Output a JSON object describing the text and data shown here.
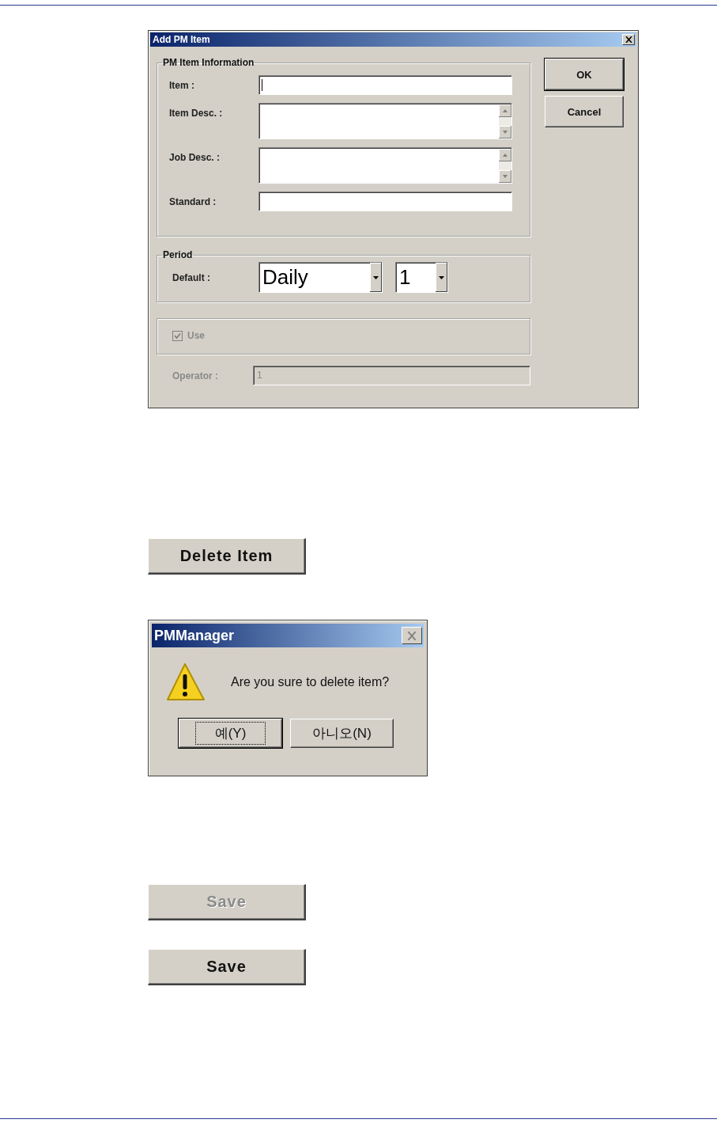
{
  "add_pm_item_dialog": {
    "title": "Add PM Item",
    "info_group": {
      "title": "PM Item Information",
      "fields": [
        {
          "label": "Item :",
          "kind": "text",
          "focused": true
        },
        {
          "label": "Item Desc. :",
          "kind": "memo",
          "focused": false
        },
        {
          "label": "Job Desc. :",
          "kind": "memo",
          "focused": false
        },
        {
          "label": "Standard :",
          "kind": "text",
          "focused": false
        }
      ]
    },
    "period_group": {
      "title": "Period",
      "label": "Default :",
      "dropdowns": [
        {
          "value": "Daily"
        },
        {
          "value": "1"
        }
      ]
    },
    "use_checkbox": {
      "label": "Use",
      "checked": true,
      "disabled": true
    },
    "operator": {
      "label": "Operator :",
      "value": "1",
      "disabled": true
    },
    "buttons": [
      {
        "label": "OK"
      },
      {
        "label": "Cancel"
      }
    ]
  },
  "delete_button": {
    "label": "Delete Item"
  },
  "confirm_dialog": {
    "title": "PMManager",
    "message": "Are you sure to delete item?",
    "buttons": [
      {
        "label": "예(Y)",
        "focused": true
      },
      {
        "label": "아니오(N)",
        "focused": false
      }
    ]
  },
  "save_buttons": [
    {
      "label": "Save",
      "disabled": true
    },
    {
      "label": "Save",
      "disabled": false
    }
  ]
}
